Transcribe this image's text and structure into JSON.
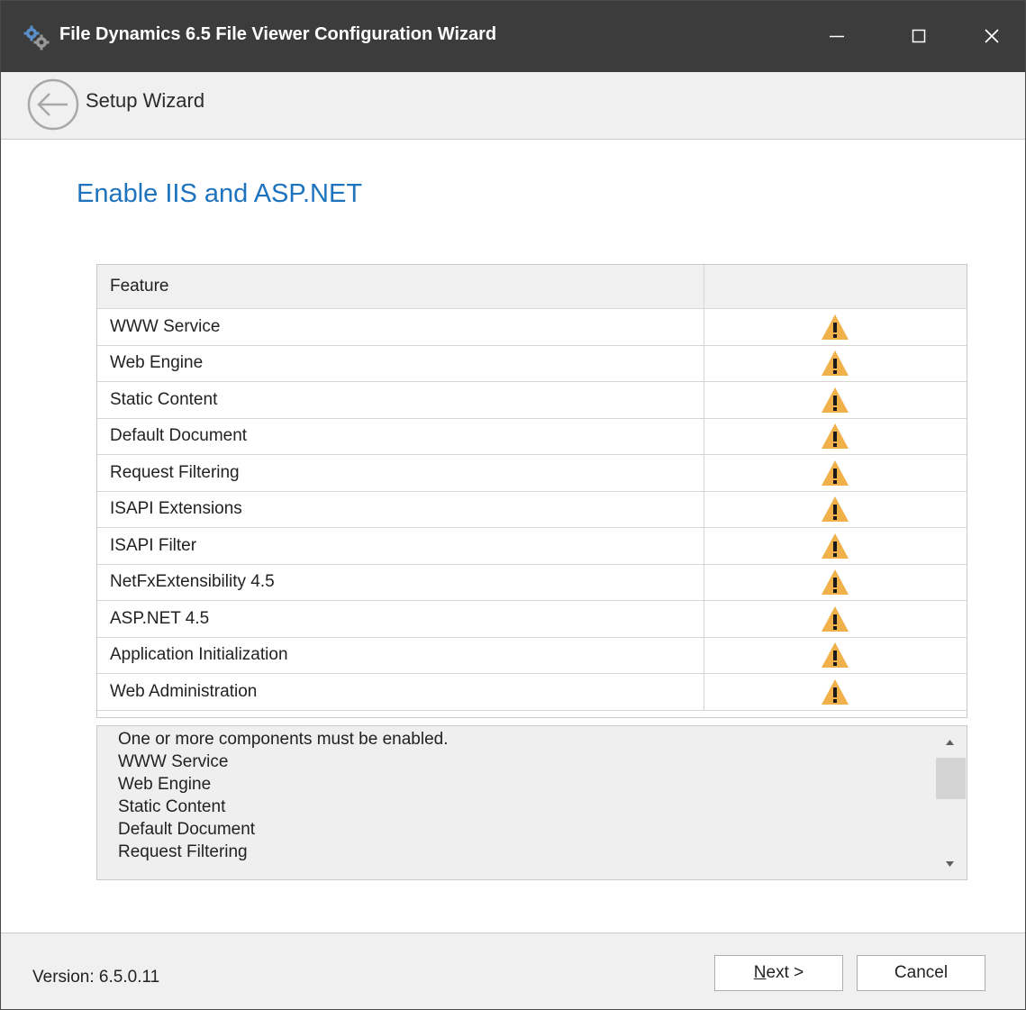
{
  "window": {
    "title": "File Dynamics 6.5 File Viewer Configuration Wizard",
    "icons": {
      "app": "gears-icon",
      "minimize": "minimize-icon",
      "maximize": "maximize-icon",
      "close": "close-icon"
    }
  },
  "nav": {
    "back_icon": "back-arrow-icon",
    "title": "Setup Wizard"
  },
  "page": {
    "title": "Enable IIS and ASP.NET"
  },
  "grid": {
    "columns": [
      "Feature",
      ""
    ],
    "status_icon": "warning-icon",
    "rows": [
      {
        "feature": "WWW Service",
        "status": "warning"
      },
      {
        "feature": "Web Engine",
        "status": "warning"
      },
      {
        "feature": "Static Content",
        "status": "warning"
      },
      {
        "feature": "Default Document",
        "status": "warning"
      },
      {
        "feature": "Request Filtering",
        "status": "warning"
      },
      {
        "feature": "ISAPI Extensions",
        "status": "warning"
      },
      {
        "feature": "ISAPI Filter",
        "status": "warning"
      },
      {
        "feature": "NetFxExtensibility 4.5",
        "status": "warning"
      },
      {
        "feature": "ASP.NET 4.5",
        "status": "warning"
      },
      {
        "feature": "Application Initialization",
        "status": "warning"
      },
      {
        "feature": "Web Administration",
        "status": "warning"
      }
    ]
  },
  "messages": {
    "lines": [
      "One or more components must be enabled.",
      "WWW Service",
      "Web Engine",
      "Static Content",
      "Default Document",
      "Request Filtering"
    ]
  },
  "footer": {
    "version": "Version: 6.5.0.11",
    "next_accel": "N",
    "next_rest": "ext >",
    "cancel": "Cancel"
  },
  "colors": {
    "titlebar": "#3c3c3c",
    "accent_title": "#1e73be",
    "warning_fill": "#f0b04a"
  }
}
